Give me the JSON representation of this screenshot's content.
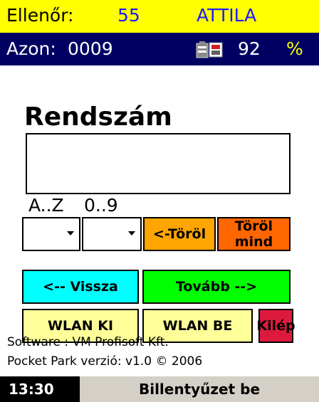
{
  "header": {
    "inspector_label": "Ellenőr:",
    "inspector_id": "55",
    "inspector_name": "ATTILA",
    "id_label": "Azon:",
    "id_value": "0009",
    "battery_value": "92",
    "battery_unit": "%"
  },
  "form": {
    "title": "Rendszám",
    "plate_value": "",
    "letters_label": "A..Z",
    "digits_label": "0..9",
    "letters_selected": "",
    "digits_selected": ""
  },
  "buttons": {
    "delete": "<-Töröl",
    "delete_all": "Töröl mind",
    "back": "<-- Vissza",
    "next": "Tovább -->",
    "wlan_off": "WLAN KI",
    "wlan_on": "WLAN BE",
    "exit": "Kilép"
  },
  "footer": {
    "software": "Software : VM Profisoft Kft.",
    "version": "Pocket Park verzió: v1.0  © 2006"
  },
  "taskbar": {
    "clock": "13:30",
    "keyboard": "Billentyűzet be"
  },
  "colors": {
    "top_bar": "#ffff00",
    "id_bar": "#000063",
    "delete": "#ffa500",
    "delete_all": "#ff6600",
    "back": "#00ffff",
    "next": "#00ff00",
    "wlan": "#ffff99",
    "exit": "#dd1a3c"
  },
  "icons": {
    "battery": "battery-plug-icon"
  }
}
